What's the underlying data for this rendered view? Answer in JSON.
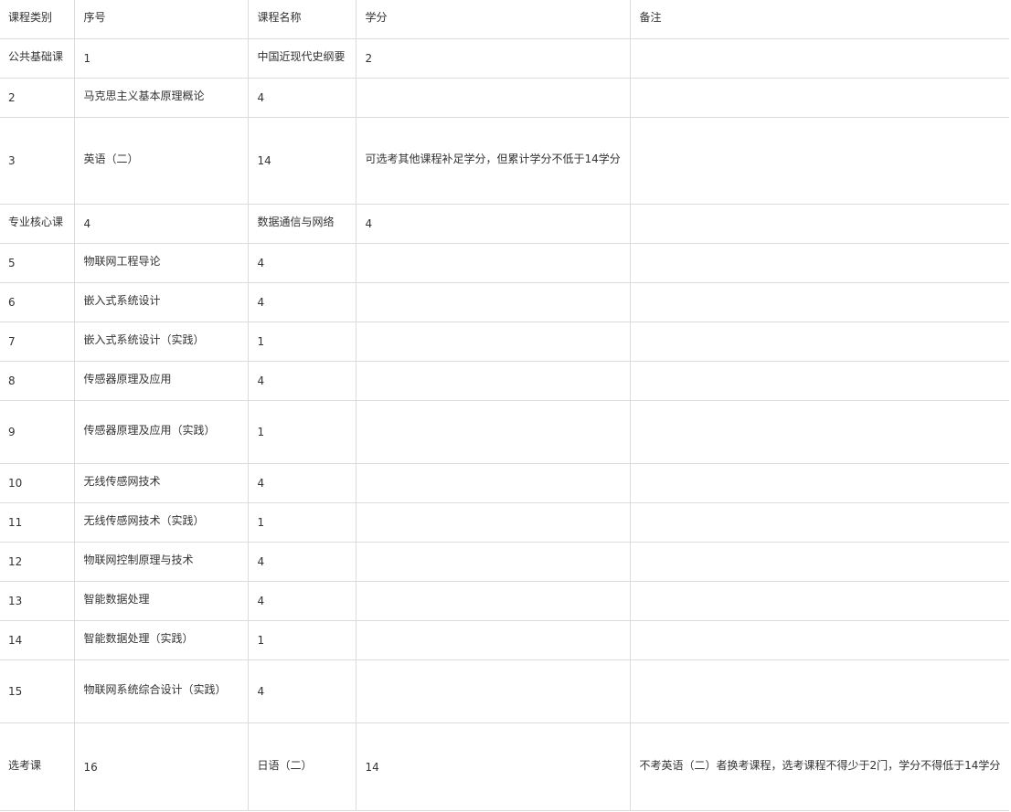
{
  "table": {
    "headers": [
      "课程类别",
      "序号",
      "课程名称",
      "学分",
      "备注"
    ],
    "rows": [
      [
        "公共基础课",
        "1",
        "中国近现代史纲要",
        "2",
        ""
      ],
      [
        "2",
        "马克思主义基本原理概论",
        "4",
        "",
        ""
      ],
      [
        "3",
        "英语（二）",
        "14",
        "可选考其他课程补足学分，但累计学分不低于14学分",
        ""
      ],
      [
        "专业核心课",
        "4",
        "数据通信与网络",
        "4",
        ""
      ],
      [
        "5",
        "物联网工程导论",
        "4",
        "",
        ""
      ],
      [
        "6",
        "嵌入式系统设计",
        "4",
        "",
        ""
      ],
      [
        "7",
        "嵌入式系统设计（实践）",
        "1",
        "",
        ""
      ],
      [
        "8",
        "传感器原理及应用",
        "4",
        "",
        ""
      ],
      [
        "9",
        "传感器原理及应用（实践）",
        "1",
        "",
        ""
      ],
      [
        "10",
        "无线传感网技术",
        "4",
        "",
        ""
      ],
      [
        "11",
        "无线传感网技术（实践）",
        "1",
        "",
        ""
      ],
      [
        "12",
        "物联网控制原理与技术",
        "4",
        "",
        ""
      ],
      [
        "13",
        "智能数据处理",
        "4",
        "",
        ""
      ],
      [
        "14",
        "智能数据处理（实践）",
        "1",
        "",
        ""
      ],
      [
        "15",
        "物联网系统综合设计（实践）",
        "4",
        "",
        ""
      ],
      [
        "选考课",
        "16",
        "日语（二）",
        "14",
        "不考英语（二）者换考课程，选考课程不得少于2门，学分不得低于14学分"
      ]
    ]
  }
}
